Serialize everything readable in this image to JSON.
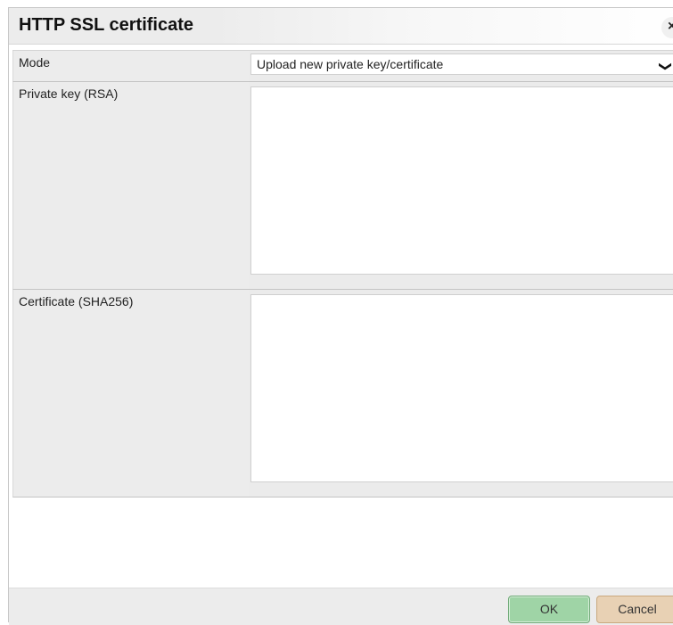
{
  "dialog": {
    "title": "HTTP SSL certificate",
    "close_glyph": "×",
    "close_icon": "close-icon"
  },
  "form": {
    "mode": {
      "label": "Mode",
      "selected": "Upload new private key/certificate",
      "chevron_glyph": "❯",
      "chevron_icon": "chevron-down-icon"
    },
    "private_key": {
      "label": "Private key (RSA)",
      "value": ""
    },
    "certificate": {
      "label": "Certificate (SHA256)",
      "value": ""
    }
  },
  "footer": {
    "ok_label": "OK",
    "cancel_label": "Cancel"
  },
  "colors": {
    "ok_bg": "#9fd4a6",
    "cancel_bg": "#e8d1b4",
    "label_bg": "#ececec"
  }
}
